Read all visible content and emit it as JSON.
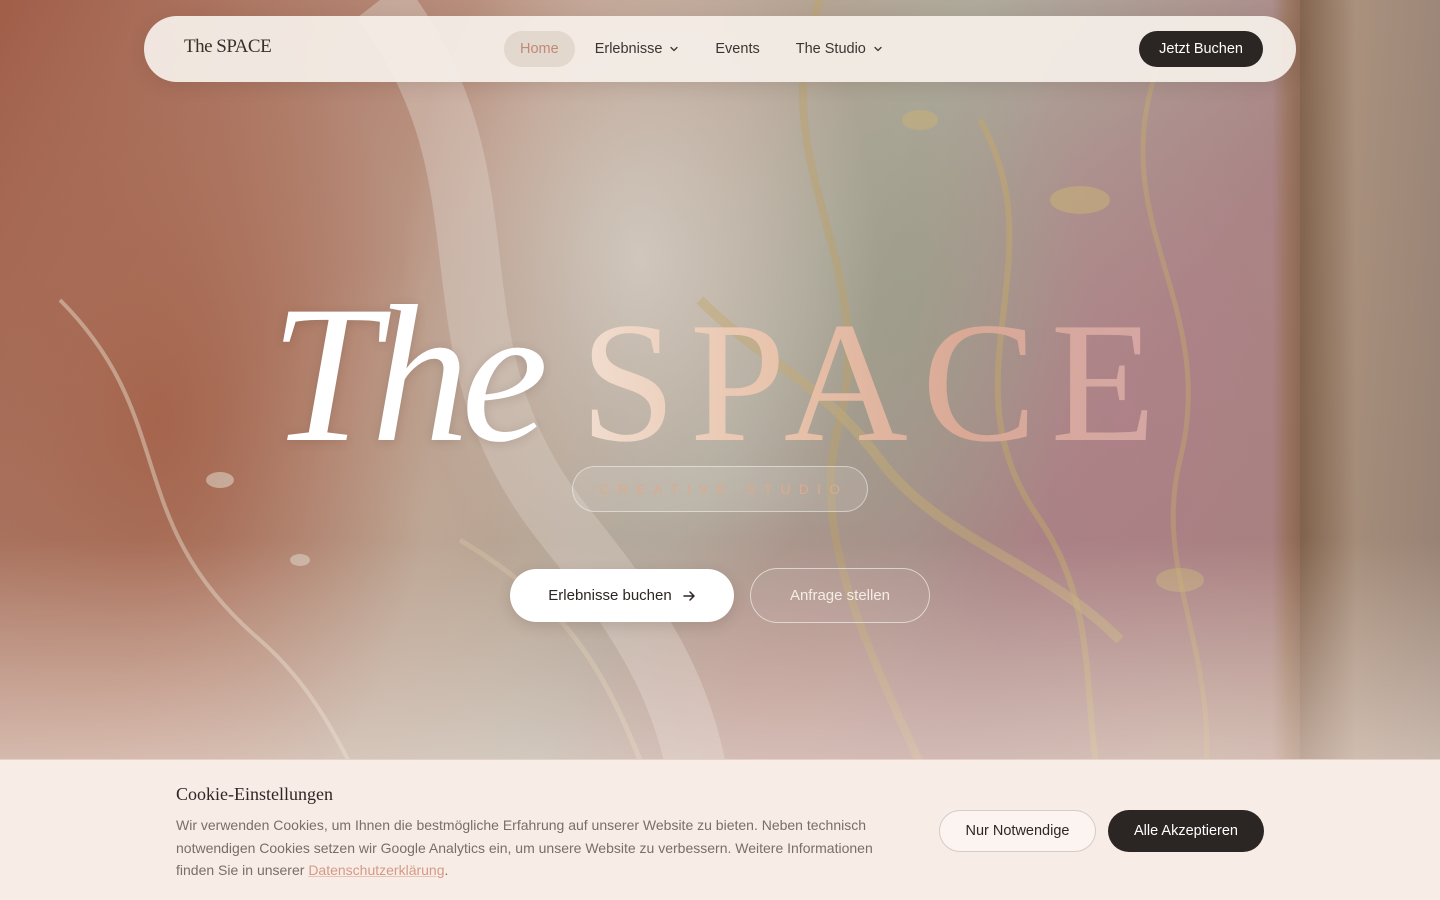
{
  "navbar": {
    "logo": "The SPACE",
    "links": [
      {
        "label": "Home",
        "active": true,
        "has_dropdown": false
      },
      {
        "label": "Erlebnisse",
        "active": false,
        "has_dropdown": true
      },
      {
        "label": "Events",
        "active": false,
        "has_dropdown": false
      },
      {
        "label": "The Studio",
        "active": false,
        "has_dropdown": true
      }
    ],
    "cta_label": "Jetzt Buchen"
  },
  "hero": {
    "title_the": "The",
    "title_space": "SPACE",
    "subtitle": "CREATIVE STUDIO",
    "primary_button": "Erlebnisse buchen",
    "secondary_button": "Anfrage stellen"
  },
  "cookie": {
    "title": "Cookie-Einstellungen",
    "text": "Wir verwenden Cookies, um Ihnen die bestmögliche Erfahrung auf unserer Website zu bieten. Neben technisch notwendigen Cookies setzen wir Google Analytics ein, um unsere Website zu verbessern. Weitere Informationen finden Sie in unserer ",
    "link_label": "Datenschutzerklärung",
    "text_end": ".",
    "necessary_button": "Nur Notwendige",
    "accept_button": "Alle Akzeptieren"
  },
  "icons": {
    "dropdown": "chevron-down-icon",
    "arrow": "arrow-right-icon"
  },
  "colors": {
    "dark": "#2b2523",
    "accent": "#c08a76",
    "link": "#d59a84",
    "banner_bg": "#f8ece6"
  }
}
